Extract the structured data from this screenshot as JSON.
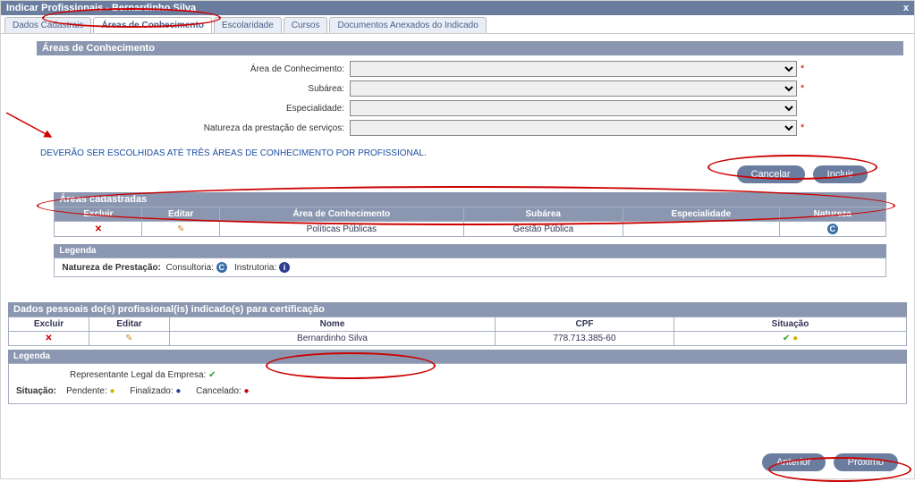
{
  "window": {
    "title": "Indicar Profissionais - Bernardinho Silva",
    "close": "x"
  },
  "tabs": {
    "dados_cadastrais": "Dados Cadastrais",
    "areas": "Áreas de Conhecimento",
    "escolaridade": "Escolaridade",
    "cursos": "Cursos",
    "docs": "Documentos Anexados do Indicado"
  },
  "section1": {
    "header": "Áreas de Conhecimento",
    "fields": {
      "area_label": "Área de Conhecimento:",
      "subarea_label": "Subárea:",
      "esp_label": "Especialidade:",
      "nat_label": "Natureza da prestação de serviços:"
    },
    "hint": "DEVERÃO SER ESCOLHIDAS ATÉ TRÊS ÁREAS DE CONHECIMENTO POR PROFISSIONAL.",
    "btn_cancel": "Cancelar",
    "btn_include": "Incluir"
  },
  "areas_cad": {
    "header": "Áreas cadastradas",
    "cols": {
      "excluir": "Excluir",
      "editar": "Editar",
      "area": "Área de Conhecimento",
      "subarea": "Subárea",
      "esp": "Especialidade",
      "nat": "Natureza"
    },
    "row": {
      "area": "Políticas Públicas",
      "subarea": "Gestão Pública",
      "esp": "",
      "nat": "C"
    }
  },
  "legend1": {
    "header": "Legenda",
    "label": "Natureza de Prestação:",
    "consultoria": "Consultoria:",
    "instrutoria": "Instrutoria:"
  },
  "section2": {
    "header": "Dados pessoais do(s) profissional(is) indicado(s) para certificação",
    "cols": {
      "excluir": "Excluir",
      "editar": "Editar",
      "nome": "Nome",
      "cpf": "CPF",
      "situacao": "Situação"
    },
    "row": {
      "nome": "Bernardinho Silva",
      "cpf": "778.713.385-60"
    }
  },
  "legend2": {
    "header": "Legenda",
    "situacao": "Situação:",
    "rep": "Representante Legal da Empresa:",
    "pend": "Pendente:",
    "fin": "Finalizado:",
    "canc": "Cancelado:"
  },
  "nav": {
    "prev": "Anterior",
    "next": "Próximo"
  }
}
